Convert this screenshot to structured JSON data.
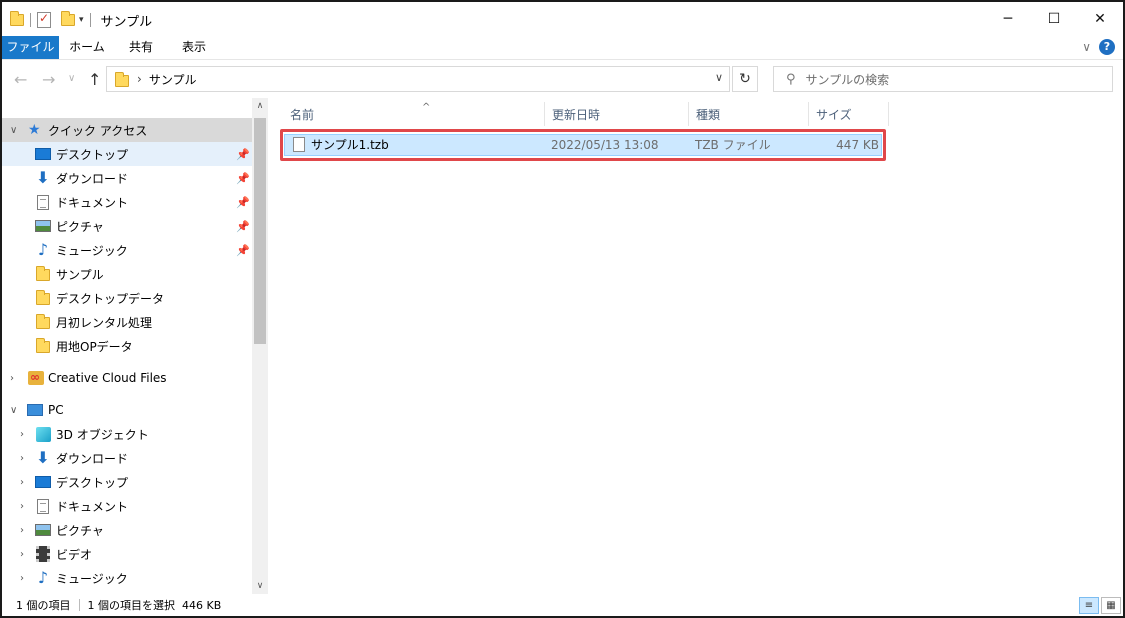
{
  "window": {
    "title": "サンプル",
    "qat_dropdown_glyph": "▾",
    "minimize_glyph": "─",
    "maximize_glyph": "☐",
    "close_glyph": "✕"
  },
  "ribbon": {
    "tabs": [
      "ファイル",
      "ホーム",
      "共有",
      "表示"
    ],
    "expand_glyph": "∨",
    "help_glyph": "?"
  },
  "address": {
    "back_glyph": "←",
    "forward_glyph": "→",
    "recent_glyph": "∨",
    "up_glyph": "↑",
    "separator_glyph": "›",
    "path": "サンプル",
    "dropdown_glyph": "∨",
    "refresh_glyph": "↻"
  },
  "search": {
    "placeholder": "サンプルの検索",
    "icon": "search-icon",
    "glyph": "⚲"
  },
  "nav": {
    "quick_access": "クイック アクセス",
    "quick_items": [
      {
        "label": "デスクトップ",
        "icon": "desktop-icon",
        "pinned": true
      },
      {
        "label": "ダウンロード",
        "icon": "download-icon",
        "pinned": true
      },
      {
        "label": "ドキュメント",
        "icon": "document-icon",
        "pinned": true
      },
      {
        "label": "ピクチャ",
        "icon": "pictures-icon",
        "pinned": true
      },
      {
        "label": "ミュージック",
        "icon": "music-icon",
        "pinned": true
      },
      {
        "label": "サンプル",
        "icon": "folder-icon",
        "pinned": false
      },
      {
        "label": "デスクトップデータ",
        "icon": "folder-icon",
        "pinned": false
      },
      {
        "label": "月初レンタル処理",
        "icon": "folder-icon",
        "pinned": false
      },
      {
        "label": "用地OPデータ",
        "icon": "folder-icon",
        "pinned": false
      }
    ],
    "creative_cloud": "Creative Cloud Files",
    "pc": "PC",
    "pc_items": [
      {
        "label": "3D オブジェクト",
        "icon": "3d-objects-icon"
      },
      {
        "label": "ダウンロード",
        "icon": "download-icon"
      },
      {
        "label": "デスクトップ",
        "icon": "desktop-icon"
      },
      {
        "label": "ドキュメント",
        "icon": "document-icon"
      },
      {
        "label": "ピクチャ",
        "icon": "pictures-icon"
      },
      {
        "label": "ビデオ",
        "icon": "video-icon"
      },
      {
        "label": "ミュージック",
        "icon": "music-icon"
      }
    ],
    "glyphs": {
      "expand": "›",
      "collapse": "∨",
      "star": "★",
      "pin": "📌",
      "download": "⬇",
      "music": "♪",
      "scroll_up": "∧",
      "scroll_down": "∨"
    }
  },
  "columns": {
    "name": "名前",
    "date": "更新日時",
    "type": "種類",
    "size": "サイズ",
    "sort_glyph": "^"
  },
  "files": [
    {
      "name": "サンプル1.tzb",
      "date": "2022/05/13 13:08",
      "type": "TZB ファイル",
      "size": "447 KB"
    }
  ],
  "status": {
    "item_count": "1 個の項目",
    "selection": "1 個の項目を選択  446 KB",
    "details_view_glyph": "≡",
    "large_icons_glyph": "▦"
  },
  "colors": {
    "file_tab": "#1979ca",
    "selection": "#cce8ff",
    "highlight_box": "#e0474a"
  }
}
